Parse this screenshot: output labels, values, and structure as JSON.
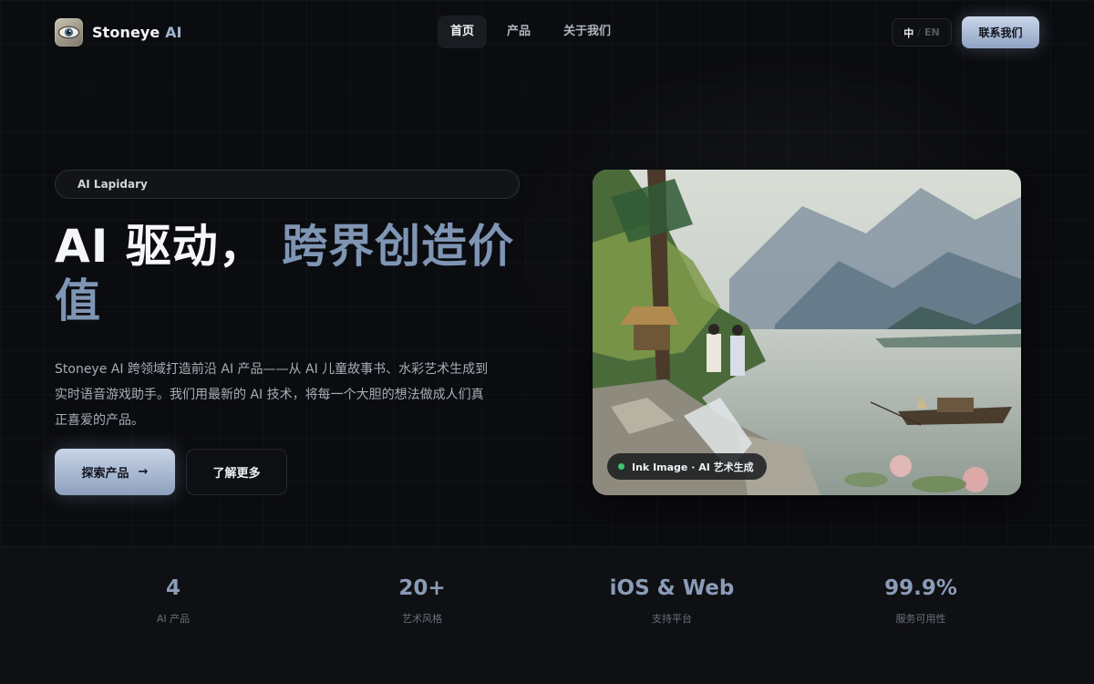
{
  "header": {
    "logo_name": "Stoneye",
    "logo_ai": "AI",
    "nav": [
      "首页",
      "产品",
      "关于我们"
    ],
    "lang_current": "中",
    "lang_sep": "/",
    "lang_other": "EN",
    "contact_label": "联系我们"
  },
  "hero": {
    "badge": "AI Lapidary",
    "title_part1": "AI 驱动，",
    "title_part2": "跨界创造价值",
    "description": "Stoneye AI 跨领域打造前沿 AI 产品——从 AI 儿童故事书、水彩艺术生成到实时语音游戏助手。我们用最新的 AI 技术，将每一个大胆的想法做成人们真正喜爱的产品。",
    "primary_button": "探索产品",
    "primary_arrow": "→",
    "secondary_button": "了解更多",
    "image_tag": "Ink Image · AI 艺术生成"
  },
  "stats": [
    {
      "value": "4",
      "label": "AI 产品"
    },
    {
      "value": "20+",
      "label": "艺术风格"
    },
    {
      "value": "iOS & Web",
      "label": "支持平台"
    },
    {
      "value": "99.9%",
      "label": "服务可用性"
    }
  ],
  "colors": {
    "accent": "#8fa3c2",
    "title_blue": "#7f95b4",
    "status_dot": "#3ec46d",
    "background": "#0b0c10"
  },
  "icons": [
    "eye-logo-icon",
    "arrow-right-icon",
    "status-dot-icon"
  ]
}
